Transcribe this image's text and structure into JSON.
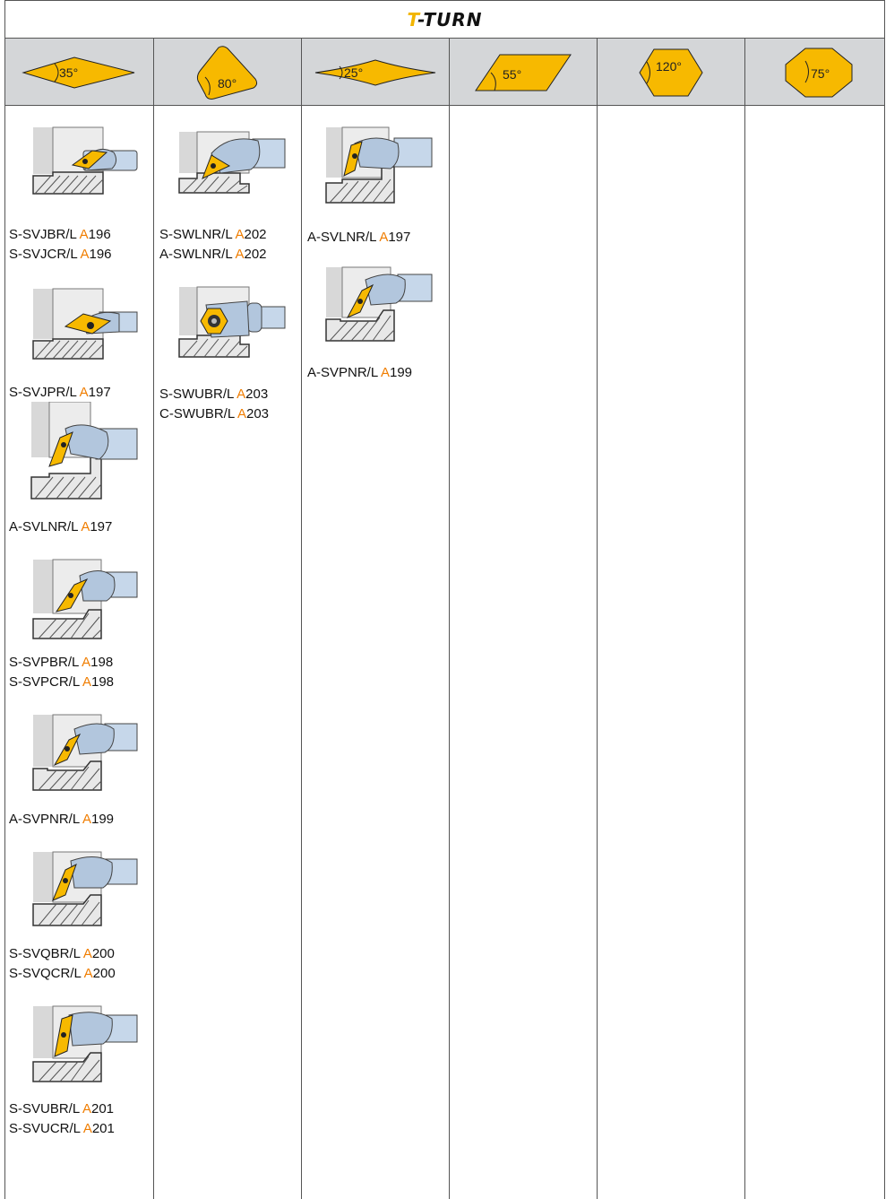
{
  "header": {
    "brand_prefix": "T",
    "brand_rest": "-TURN"
  },
  "shapes": [
    {
      "angle": "35°",
      "icon": "diamond-35-insert-icon"
    },
    {
      "angle": "80°",
      "icon": "trigon-80-insert-icon"
    },
    {
      "angle": "25°",
      "icon": "diamond-25-insert-icon"
    },
    {
      "angle": "55°",
      "icon": "parallelogram-55-insert-icon"
    },
    {
      "angle": "120°",
      "icon": "hexagon-120-insert-icon"
    },
    {
      "angle": "75°",
      "icon": "octagon-75-insert-icon"
    }
  ],
  "columns": [
    {
      "groups": [
        {
          "lines": [
            {
              "code": "S-SVJBR/L",
              "prefix": "A",
              "page": "196"
            },
            {
              "code": "S-SVJCR/L",
              "prefix": "A",
              "page": "196"
            }
          ]
        },
        {
          "lines": [
            {
              "code": "S-SVJPR/L",
              "prefix": "A",
              "page": "197"
            }
          ]
        },
        {
          "lines": [
            {
              "code": "A-SVLNR/L",
              "prefix": "A",
              "page": "197"
            }
          ]
        },
        {
          "lines": [
            {
              "code": "S-SVPBR/L",
              "prefix": "A",
              "page": "198"
            },
            {
              "code": "S-SVPCR/L",
              "prefix": "A",
              "page": "198"
            }
          ]
        },
        {
          "lines": [
            {
              "code": "A-SVPNR/L",
              "prefix": "A",
              "page": "199"
            }
          ]
        },
        {
          "lines": [
            {
              "code": "S-SVQBR/L",
              "prefix": "A",
              "page": "200"
            },
            {
              "code": "S-SVQCR/L",
              "prefix": "A",
              "page": "200"
            }
          ]
        },
        {
          "lines": [
            {
              "code": "S-SVUBR/L",
              "prefix": "A",
              "page": "201"
            },
            {
              "code": "S-SVUCR/L",
              "prefix": "A",
              "page": "201"
            }
          ]
        }
      ]
    },
    {
      "groups": [
        {
          "lines": [
            {
              "code": "S-SWLNR/L",
              "prefix": "A",
              "page": "202"
            },
            {
              "code": "A-SWLNR/L",
              "prefix": "A",
              "page": "202"
            }
          ]
        },
        {
          "lines": [
            {
              "code": "S-SWUBR/L",
              "prefix": "A",
              "page": "203"
            },
            {
              "code": "C-SWUBR/L",
              "prefix": "A",
              "page": "203"
            }
          ]
        }
      ]
    },
    {
      "groups": [
        {
          "lines": [
            {
              "code": "A-SVLNR/L",
              "prefix": "A",
              "page": "197"
            }
          ]
        },
        {
          "lines": [
            {
              "code": "A-SVPNR/L",
              "prefix": "A",
              "page": "199"
            }
          ]
        }
      ]
    }
  ],
  "colors": {
    "insert_yellow": "#f7b900",
    "accent_orange": "#f07d00",
    "header_gray": "#d4d6d8"
  }
}
